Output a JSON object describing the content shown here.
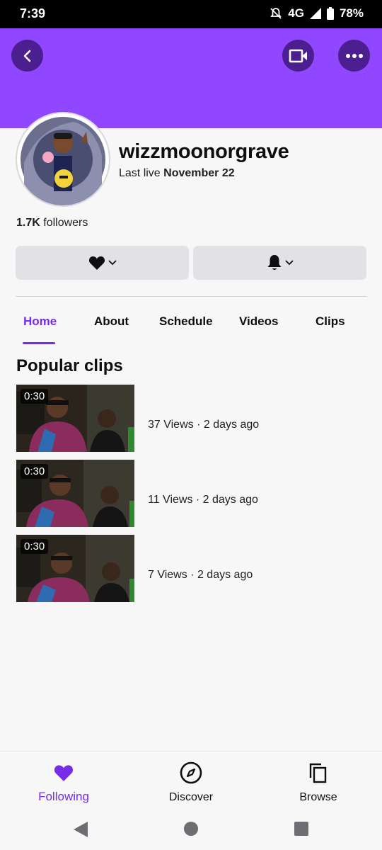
{
  "status_bar": {
    "time": "7:39",
    "network": "4G",
    "battery": "78%"
  },
  "channel": {
    "name": "wizzmoonorgrave",
    "last_live_prefix": "Last live",
    "last_live_date": "November 22",
    "followers_count": "1.7K",
    "followers_label": "followers"
  },
  "tabs": [
    {
      "label": "Home",
      "active": true
    },
    {
      "label": "About"
    },
    {
      "label": "Schedule"
    },
    {
      "label": "Videos"
    },
    {
      "label": "Clips"
    }
  ],
  "section_title": "Popular clips",
  "clips": [
    {
      "duration": "0:30",
      "meta": "37 Views · 2 days ago"
    },
    {
      "duration": "0:30",
      "meta": "11 Views · 2 days ago"
    },
    {
      "duration": "0:30",
      "meta": "7 Views · 2 days ago"
    }
  ],
  "bottom_nav": [
    {
      "label": "Following",
      "icon": "heart-icon",
      "active": true
    },
    {
      "label": "Discover",
      "icon": "compass-icon"
    },
    {
      "label": "Browse",
      "icon": "copy-icon"
    }
  ],
  "colors": {
    "brand": "#9147ff",
    "accent": "#772ce8",
    "button_dark": "#4b1f8f"
  }
}
